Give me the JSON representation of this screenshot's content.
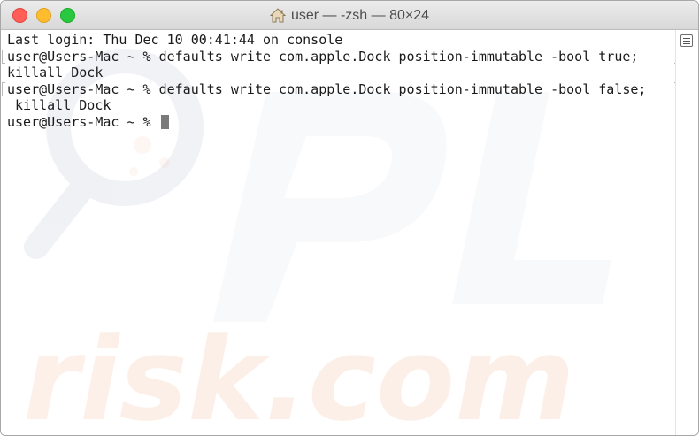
{
  "window": {
    "title": "user — -zsh — 80×24",
    "title_icon": "home-icon"
  },
  "colors": {
    "close": "#ff5f57",
    "minimize": "#ffbd2e",
    "zoom": "#28c940",
    "text": "#1a1a1a",
    "cursor": "#7a7a7a"
  },
  "terminal": {
    "lines": [
      {
        "text": "Last login: Thu Dec 10 00:41:44 on console",
        "bracketed": false
      },
      {
        "text": "user@Users-Mac ~ % defaults write com.apple.Dock position-immutable -bool true;",
        "bracketed": true
      },
      {
        "text": "killall Dock",
        "bracketed": false
      },
      {
        "text": "user@Users-Mac ~ % defaults write com.apple.Dock position-immutable -bool false;",
        "bracketed": true
      },
      {
        "text": " killall Dock",
        "bracketed": false
      },
      {
        "text": "user@Users-Mac ~ % ",
        "bracketed": false,
        "cursor": true
      }
    ]
  }
}
